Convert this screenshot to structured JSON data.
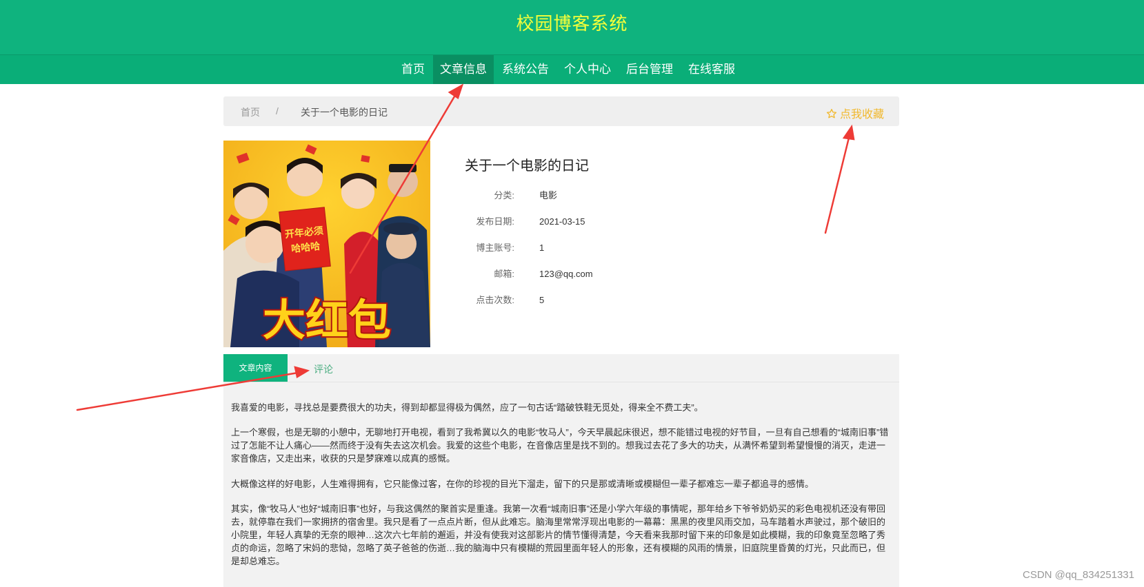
{
  "header": {
    "site_title": "校园博客系统"
  },
  "nav": {
    "items": [
      {
        "label": "首页",
        "active": false
      },
      {
        "label": "文章信息",
        "active": true
      },
      {
        "label": "系统公告",
        "active": false
      },
      {
        "label": "个人中心",
        "active": false
      },
      {
        "label": "后台管理",
        "active": false
      },
      {
        "label": "在线客服",
        "active": false
      }
    ]
  },
  "breadcrumb": {
    "home": "首页",
    "separator": "/",
    "current": "关于一个电影的日记"
  },
  "favorite": {
    "label": "点我收藏",
    "icon": "star-outline-icon",
    "color": "#f1b82d"
  },
  "poster": {
    "title_text": "大红包",
    "badge_lines": [
      "开年必须",
      "哈哈哈"
    ]
  },
  "article": {
    "title": "关于一个电影的日记",
    "fields": [
      {
        "label": "分类:",
        "value": "电影"
      },
      {
        "label": "发布日期:",
        "value": "2021-03-15"
      },
      {
        "label": "博主账号:",
        "value": "1"
      },
      {
        "label": "邮箱:",
        "value": "123@qq.com"
      },
      {
        "label": "点击次数:",
        "value": "5"
      }
    ]
  },
  "tabs": {
    "content_label": "文章内容",
    "comment_label": "评论"
  },
  "content": {
    "paragraphs": [
      "我喜爱的电影，寻找总是要费很大的功夫，得到却都显得极为偶然，应了一句古话“踏破铁鞋无觅处，得来全不费工夫”。",
      " 上一个寒假，也是无聊的小憩中，无聊地打开电视，看到了我希冀以久的电影“牧马人”，今天早晨起床很迟，想不能错过电视的好节目，一旦有自己想看的“城南旧事”错过了怎能不让人痛心——然而终于没有失去这次机会。我爱的这些个电影，在音像店里是找不到的。想我过去花了多大的功夫，从满怀希望到希望慢慢的消灭，走进一家音像店，又走出来，收获的只是梦寐难以成真的感慨。",
      " 大概像这样的好电影，人生难得拥有，它只能像过客，在你的珍视的目光下溜走，留下的只是那或清晰或模糊但一辈子都难忘一辈子都追寻的感情。",
      " 其实，像“牧马人”也好“城南旧事”也好，与我这偶然的聚首实是重逢。我第一次看“城南旧事”还是小学六年级的事情呢，那年给乡下爷爷奶奶买的彩色电视机还没有带回去，就停靠在我们一家拥挤的宿舍里。我只是看了一点点片断，但从此难忘。脑海里常常浮现出电影的一幕幕：黑黑的夜里风雨交加，马车踏着水声驶过，那个破旧的小院里，年轻人真挚的无奈的眼神…这次六七年前的邂逅，并没有使我对这部影片的情节懂得清楚，今天看来我那时留下来的印象是如此模糊，我的印象竟至忽略了秀贞的命运，忽略了宋妈的悲恸，忽略了英子爸爸的伤逝…我的脑海中只有模糊的荒园里面年轻人的形象，还有模糊的风雨的情景，旧庭院里昏黄的灯光，只此而已，但是却总难忘。"
    ]
  },
  "colors": {
    "primary": "#0fb37e",
    "nav_active": "#0a8f62",
    "title_yellow": "#f5ff3a",
    "annotation_red": "#ee3b36"
  },
  "watermark": "CSDN @qq_834251331"
}
